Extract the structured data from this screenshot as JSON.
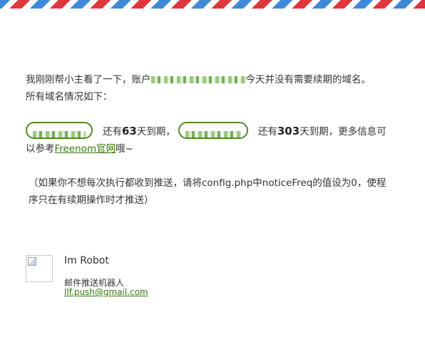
{
  "email": {
    "line1_prefix": "我刚刚帮小主看了一下，账户",
    "line1_suffix": "今天并没有需要续期的域名。",
    "line2": "所有域名情况如下：",
    "domain1_text": "还有",
    "domain1_days": "63",
    "domain1_suffix": "天到期，",
    "domain2_text": "还有",
    "domain2_days": "303",
    "domain2_suffix": "天到期，更多信息可",
    "line4_prefix": "以参考",
    "freenom_link": "Freenom官网",
    "line4_suffix": "哦~",
    "note_line1": "（如果你不想每次执行都收到推送，请将config.php中noticeFreq的值设为0，使程",
    "note_line2": "序只在有续期操作时才推送）"
  },
  "signature": {
    "name": "Im Robot",
    "role": "邮件推送机器人",
    "email": "llf.push@gmail.com"
  },
  "colors": {
    "link_green": "#35780b",
    "pill_border": "#4f8a25",
    "airmail_red": "#e0363d",
    "airmail_blue": "#3f8ad8"
  }
}
